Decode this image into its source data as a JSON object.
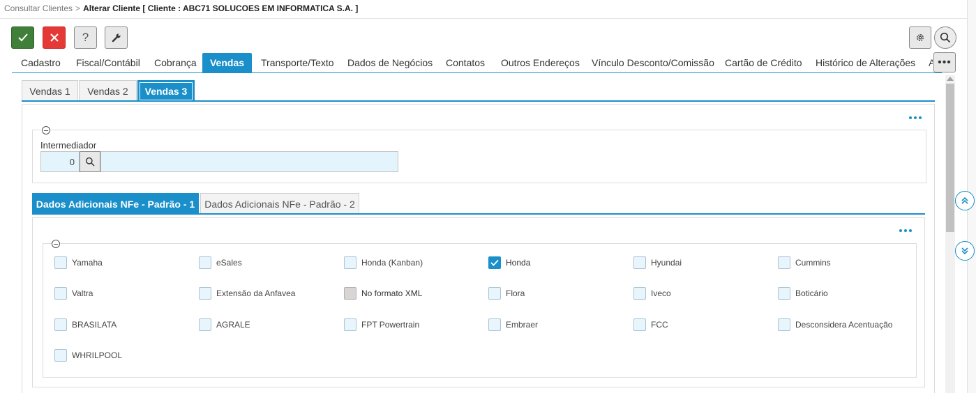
{
  "breadcrumb": {
    "parent": "Consultar Clientes",
    "separator": ">",
    "current": "Alterar Cliente [ Cliente : ABC71 SOLUCOES EM INFORMATICA S.A. ]"
  },
  "toolbar": {
    "confirm_icon": "check-icon",
    "cancel_icon": "close-icon",
    "help_label": "?",
    "tools_icon": "wrench-icon",
    "settings_icon": "gear-icon",
    "search_icon": "search-icon"
  },
  "main_tabs": [
    {
      "label": "Cadastro"
    },
    {
      "label": "Fiscal/Contábil"
    },
    {
      "label": "Cobrança"
    },
    {
      "label": "Vendas",
      "active": true
    },
    {
      "label": "Transporte/Texto"
    },
    {
      "label": "Dados de Negócios"
    },
    {
      "label": "Contatos"
    },
    {
      "label": "Outros Endereços"
    },
    {
      "label": "Vínculo Desconto/Comissão"
    },
    {
      "label": "Cartão de Crédito"
    },
    {
      "label": "Histórico de Alterações"
    },
    {
      "label": "A"
    }
  ],
  "more_tabs_label": "•••",
  "sub_tabs": [
    {
      "label": "Vendas 1"
    },
    {
      "label": "Vendas 2"
    },
    {
      "label": "Vendas 3",
      "active": true
    }
  ],
  "intermediador": {
    "label": "Intermediador",
    "code_value": "0",
    "description_value": ""
  },
  "nfe_tabs": [
    {
      "label": "Dados Adicionais NFe - Padrão - 1",
      "active": true
    },
    {
      "label": "Dados Adicionais NFe - Padrão - 2"
    }
  ],
  "checkboxes": [
    {
      "label": "Yamaha",
      "checked": false
    },
    {
      "label": "eSales",
      "checked": false
    },
    {
      "label": "Honda (Kanban)",
      "checked": false
    },
    {
      "label": "Honda",
      "checked": true
    },
    {
      "label": "Hyundai",
      "checked": false
    },
    {
      "label": "Cummins",
      "checked": false
    },
    {
      "label": "Valtra",
      "checked": false
    },
    {
      "label": "Extensão da Anfavea",
      "checked": false
    },
    {
      "label": "No formato XML",
      "checked": false,
      "disabled": true
    },
    {
      "label": "Flora",
      "checked": false
    },
    {
      "label": "Iveco",
      "checked": false
    },
    {
      "label": "Boticário",
      "checked": false
    },
    {
      "label": "BRASILATA",
      "checked": false
    },
    {
      "label": "AGRALE",
      "checked": false
    },
    {
      "label": "FPT Powertrain",
      "checked": false
    },
    {
      "label": "Embraer",
      "checked": false
    },
    {
      "label": "FCC",
      "checked": false
    },
    {
      "label": "Desconsidera Acentuação",
      "checked": false
    },
    {
      "label": "WHRILPOOL",
      "checked": false
    }
  ],
  "colors": {
    "accent": "#1a8fc9",
    "confirm": "#3f7f3a",
    "cancel": "#e53935",
    "input_bg": "#e3f4fc"
  }
}
